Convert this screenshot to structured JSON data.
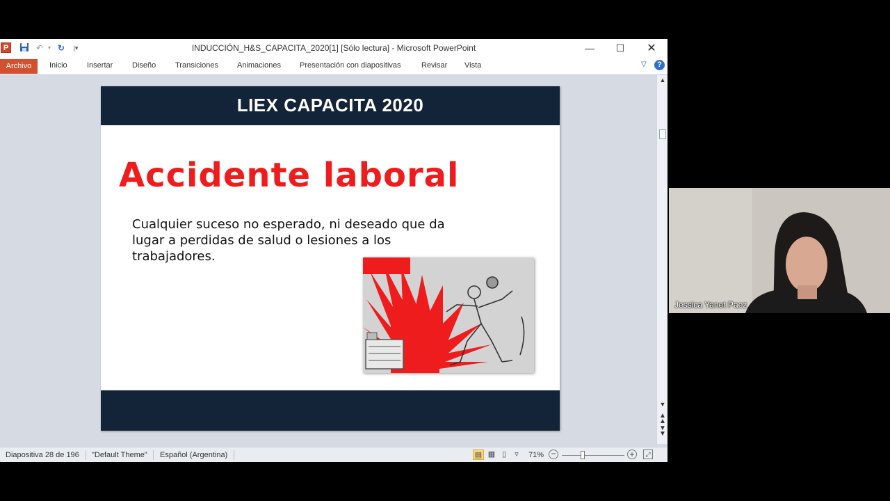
{
  "window": {
    "title": "INDUCCIÓN_H&S_CAPACITA_2020[1] [Sólo lectura]  -  Microsoft PowerPoint",
    "app_icon_letter": "P"
  },
  "ribbon": {
    "tabs": [
      {
        "label": "Archivo",
        "active": true
      },
      {
        "label": "Inicio"
      },
      {
        "label": "Insertar"
      },
      {
        "label": "Diseño"
      },
      {
        "label": "Transiciones"
      },
      {
        "label": "Animaciones"
      },
      {
        "label": "Presentación con diapositivas"
      },
      {
        "label": "Revisar"
      },
      {
        "label": "Vista"
      }
    ]
  },
  "slide": {
    "title": "LIEX CAPACITA 2020",
    "heading": "Accidente laboral",
    "body": "Cualquier suceso no esperado, ni deseado que da lugar a perdidas de salud o lesiones a los trabajadores.",
    "colors": {
      "band": "#142438",
      "heading": "#ee1c1c"
    }
  },
  "statusbar": {
    "slide_counter": "Diapositiva 28 de 196",
    "theme": "\"Default Theme\"",
    "language": "Español (Argentina)",
    "zoom": "71%"
  },
  "video": {
    "participant_name": "Jessica Yanet Paez"
  },
  "icons": [
    "powerpoint-app-icon",
    "save-icon",
    "undo-icon",
    "redo-icon",
    "minimize-icon",
    "maximize-icon",
    "close-icon",
    "help-icon"
  ]
}
